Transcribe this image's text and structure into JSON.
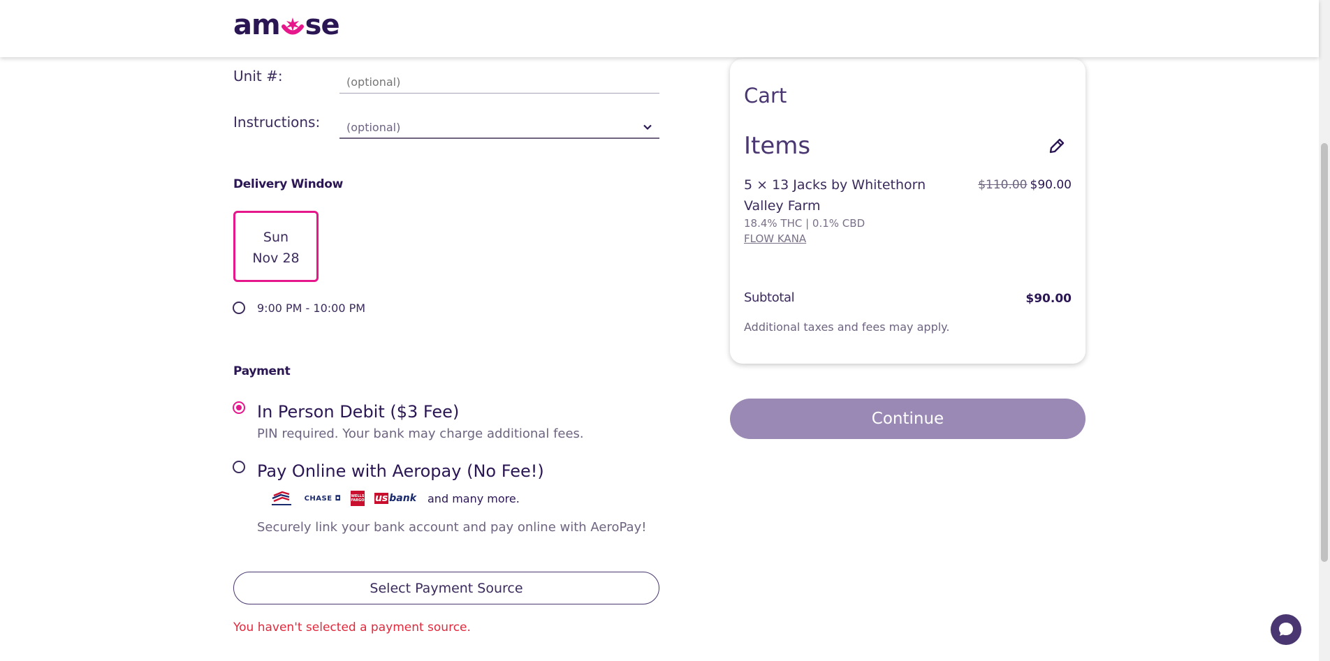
{
  "header": {
    "logo_text_left": "am",
    "logo_text_right": "se"
  },
  "address": {
    "unit_label": "Unit #:",
    "unit_placeholder": "(optional)",
    "instructions_label": "Instructions:",
    "instructions_value": "(optional)"
  },
  "delivery": {
    "title": "Delivery Window",
    "day": "Sun",
    "date": "Nov 28",
    "time_slot": "9:00 PM - 10:00 PM"
  },
  "payment": {
    "title": "Payment",
    "options": [
      {
        "title": "In Person Debit ($3 Fee)",
        "subtitle": "PIN required. Your bank may charge additional fees.",
        "selected": true
      },
      {
        "title": "Pay Online with Aeropay (No Fee!)",
        "subtitle": "Securely link your bank account and pay online with AeroPay!",
        "selected": false
      }
    ],
    "banks": {
      "chase": "CHASE",
      "wf": "WELLS FARGO",
      "usb_us": "us",
      "usb_bank": "bank",
      "more": "and many more."
    },
    "select_source_label": "Select Payment Source",
    "error": "You haven't selected a payment source."
  },
  "cart": {
    "title": "Cart",
    "items_title": "Items",
    "item": {
      "name": "5 × 13 Jacks by Whitethorn Valley Farm",
      "old_price": "$110.00",
      "price": "$90.00",
      "meta": "18.4% THC | 0.1% CBD",
      "brand": "FLOW KANA"
    },
    "subtotal_label": "Subtotal",
    "subtotal_value": "$90.00",
    "taxes_note": "Additional taxes and fees may apply."
  },
  "continue_label": "Continue",
  "colors": {
    "accent_pink": "#e6178b",
    "brand_purple": "#2b1654",
    "button_purple": "#9a89b4",
    "error_red": "#e0293c"
  }
}
